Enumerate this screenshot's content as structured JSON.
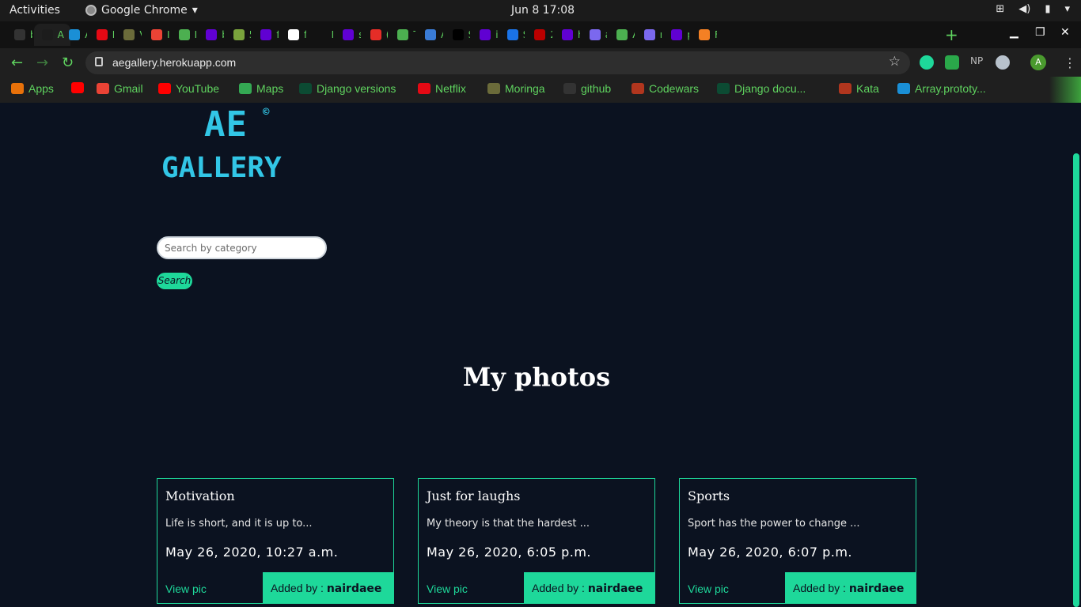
{
  "os": {
    "activities": "Activities",
    "app_name": "Google Chrome",
    "clock": "Jun 8  17:08"
  },
  "tabs": [
    {
      "label": "b",
      "color": "#333333"
    },
    {
      "label": "A",
      "color": "#1c1c1c",
      "active": true
    },
    {
      "label": "A",
      "color": "#1a8fd6"
    },
    {
      "label": "N",
      "color": "#e50914"
    },
    {
      "label": "V",
      "color": "#6b6b3a"
    },
    {
      "label": "I",
      "color": "#ea4335"
    },
    {
      "label": "D",
      "color": "#4caf50"
    },
    {
      "label": "b",
      "color": "#6001d2"
    },
    {
      "label": "5",
      "color": "#7aa33c"
    },
    {
      "label": "f",
      "color": "#6001d2"
    },
    {
      "label": "f",
      "color": "#ffffff"
    },
    {
      "label": "New",
      "color": "#121212"
    },
    {
      "label": "s",
      "color": "#6001d2"
    },
    {
      "label": "(",
      "color": "#e52d27"
    },
    {
      "label": "T",
      "color": "#4caf50"
    },
    {
      "label": "A",
      "color": "#3a7bd5"
    },
    {
      "label": "S",
      "color": "#000000"
    },
    {
      "label": "i",
      "color": "#6001d2"
    },
    {
      "label": "S",
      "color": "#1a73e8"
    },
    {
      "label": "2",
      "color": "#bb0000"
    },
    {
      "label": "h",
      "color": "#6001d2"
    },
    {
      "label": "a",
      "color": "#7b68ee"
    },
    {
      "label": "A",
      "color": "#4caf50"
    },
    {
      "label": "n",
      "color": "#7b68ee"
    },
    {
      "label": "p",
      "color": "#6001d2"
    },
    {
      "label": "F",
      "color": "#f48024"
    }
  ],
  "omnibox": {
    "url": "aegallery.herokuapp.com"
  },
  "bookmarks": [
    {
      "label": "Apps",
      "color": "#e8710a"
    },
    {
      "label": "",
      "color": "#ff0000"
    },
    {
      "label": "Gmail",
      "color": "#ea4335"
    },
    {
      "label": "YouTube",
      "color": "#ff0000"
    },
    {
      "label": "Maps",
      "color": "#34a853"
    },
    {
      "label": "Django versions",
      "color": "#0c4b33"
    },
    {
      "label": "Netflix",
      "color": "#e50914"
    },
    {
      "label": "Moringa",
      "color": "#6b6b3a"
    },
    {
      "label": "github",
      "color": "#333333"
    },
    {
      "label": "Codewars",
      "color": "#b1361e"
    },
    {
      "label": "Django docu...",
      "color": "#0c4b33"
    },
    {
      "label": "Kata",
      "color": "#b1361e"
    },
    {
      "label": "Array.prototy...",
      "color": "#1a8fd6"
    }
  ],
  "logo": {
    "ae": "AE",
    "copyright": "©",
    "gallery": "GALLERY"
  },
  "search": {
    "placeholder": "Search by category",
    "button": "Search"
  },
  "heading": "My photos",
  "cards": [
    {
      "title": "Motivation",
      "description": "Life is short, and it is up to...",
      "date": "May 26, 2020, 10:27 a.m.",
      "view": "View pic",
      "added_prefix": "Added by :",
      "author": "nairdaee"
    },
    {
      "title": "Just for laughs",
      "description": "My theory is that the hardest ...",
      "date": "May 26, 2020, 6:05 p.m.",
      "view": "View pic",
      "added_prefix": "Added by :",
      "author": "nairdaee"
    },
    {
      "title": "Sports",
      "description": "Sport has the power to change ...",
      "date": "May 26, 2020, 6:07 p.m.",
      "view": "View pic",
      "added_prefix": "Added by :",
      "author": "nairdaee"
    }
  ],
  "colors": {
    "accent": "#1ed89a",
    "page_bg": "#0b1220",
    "logo": "#32c6e6",
    "chrome_text": "#5fd35f"
  }
}
